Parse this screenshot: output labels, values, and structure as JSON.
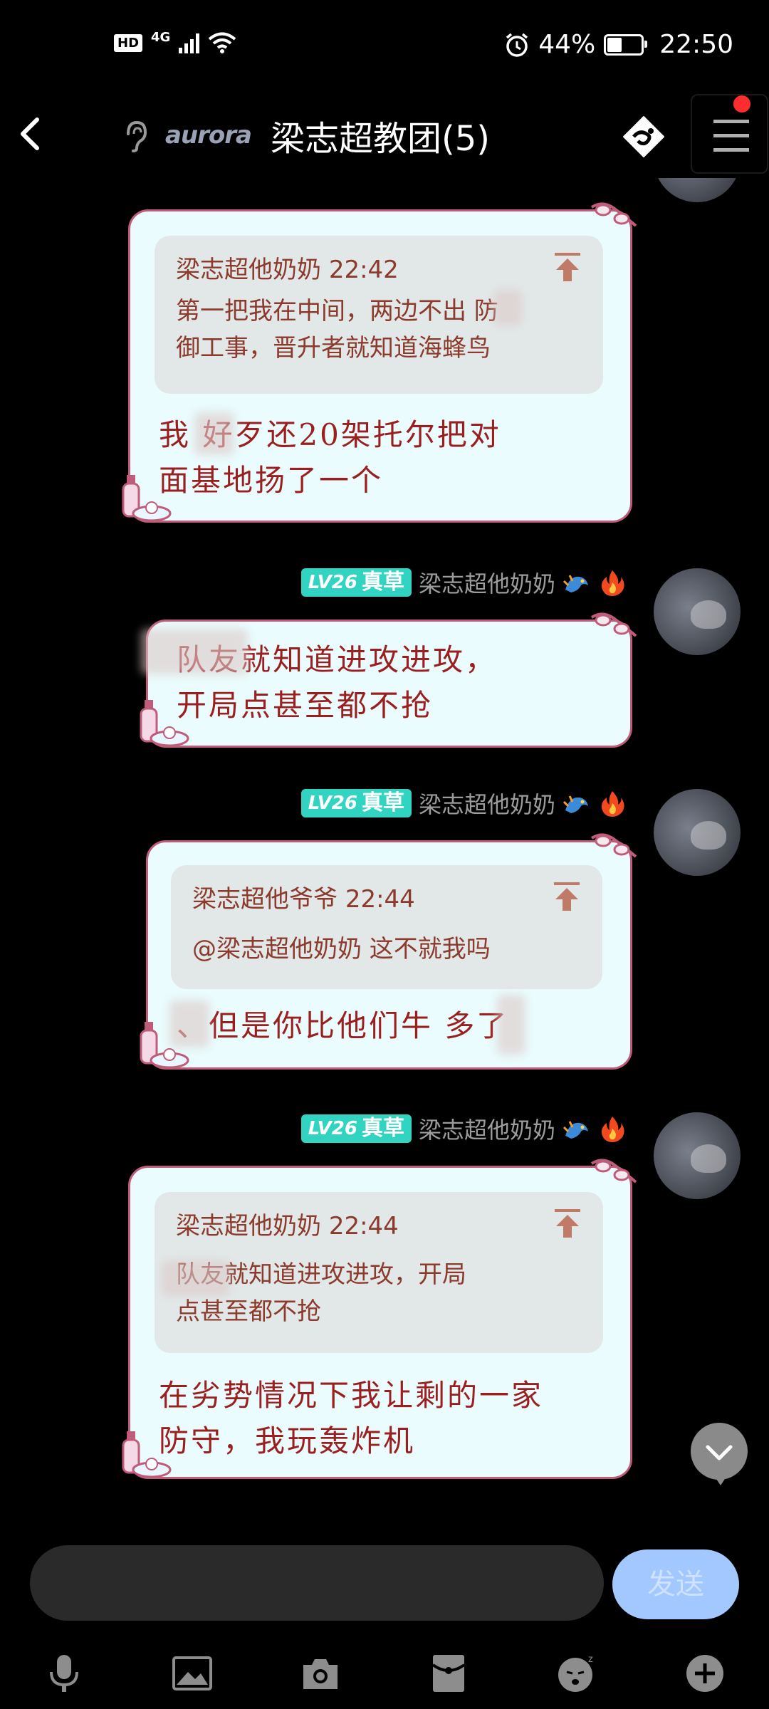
{
  "status_bar": {
    "hd": "HD",
    "network": "4G",
    "battery": "44%",
    "time": "22:50",
    "battery_level": 0.44
  },
  "header": {
    "logo": "aurora",
    "title": "梁志超教团(5)"
  },
  "messages": [
    {
      "quote": {
        "author": "梁志超他奶奶",
        "time": "22:42",
        "lines": [
          "第一把我在中间，两边不出  防",
          "御工事，晋升者就知道海蜂鸟"
        ]
      },
      "text_lines": [
        "我    好歹还20架托尔把对",
        "面基地扬了一个"
      ]
    },
    {
      "sender": {
        "level_label": "LV26",
        "title_badge": "真草",
        "name": "梁志超他奶奶"
      },
      "text_lines": [
        "      队友就知道进攻进攻，",
        "开局点甚至都不抢"
      ]
    },
    {
      "sender": {
        "level_label": "LV26",
        "title_badge": "真草",
        "name": "梁志超他奶奶"
      },
      "quote": {
        "author": "梁志超他爷爷",
        "time": "22:44",
        "lines": [
          "@梁志超他奶奶 这不就我吗"
        ]
      },
      "text_lines": [
        "  、但是你比他们牛  多了"
      ]
    },
    {
      "sender": {
        "level_label": "LV26",
        "title_badge": "真草",
        "name": "梁志超他奶奶"
      },
      "quote": {
        "author": "梁志超他奶奶",
        "time": "22:44",
        "lines": [
          "      队友就知道进攻进攻，开局",
          "点甚至都不抢"
        ]
      },
      "text_lines": [
        "在劣势情况下我让剩的一家",
        "防守，我玩轰炸机"
      ]
    }
  ],
  "composer": {
    "input_value": "",
    "send_label": "发送"
  },
  "toolbar_icons": [
    "microphone-icon",
    "image-icon",
    "camera-icon",
    "red-packet-icon",
    "emoji-icon",
    "plus-icon"
  ],
  "colors": {
    "background": "#000000",
    "bubble_bg": "#eafcfd",
    "bubble_border": "#bf5c79",
    "quote_bg": "#e2e8e8",
    "text_red": "#9c1f1f",
    "level_badge": "#31d4c1",
    "send_button": "#a3c7ff",
    "notification_dot": "#ff2d2d"
  }
}
